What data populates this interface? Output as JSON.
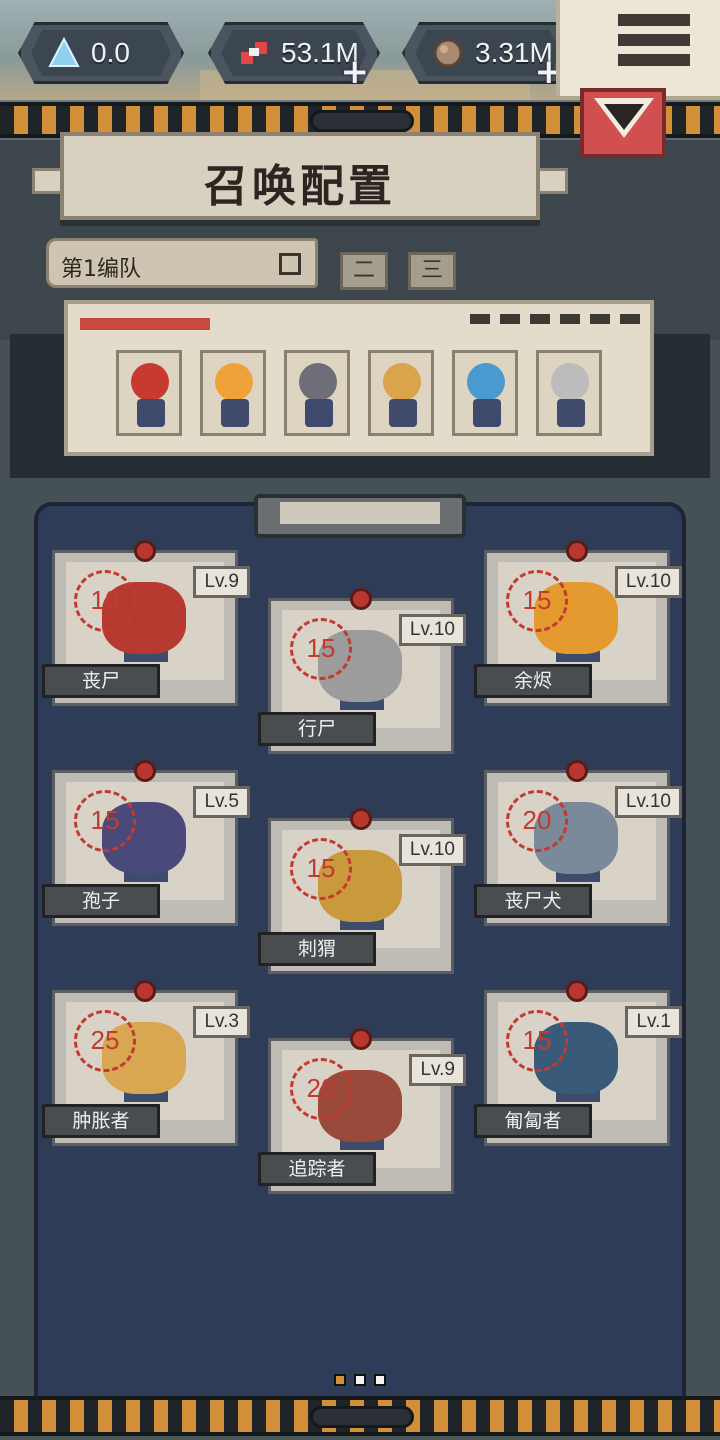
{
  "resources": [
    {
      "icon": "crystal-icon",
      "value": "0.0",
      "has_plus": false
    },
    {
      "icon": "gene-icon",
      "value": "53.1M",
      "has_plus": true
    },
    {
      "icon": "ore-icon",
      "value": "3.31M",
      "has_plus": true
    }
  ],
  "header": {
    "title": "召唤配置",
    "team_label": "第1编队",
    "team_tabs": [
      "二",
      "三"
    ]
  },
  "formation": {
    "slots": [
      "apple",
      "ember",
      "walker",
      "hedgehog",
      "spore-blue",
      "ghost"
    ]
  },
  "cards": [
    {
      "name": "丧尸",
      "level": "Lv.9",
      "cost": "10",
      "color": "#b63a30"
    },
    {
      "name": "行尸",
      "level": "Lv.10",
      "cost": "15",
      "color": "#9c9c9c"
    },
    {
      "name": "余烬",
      "level": "Lv.10",
      "cost": "15",
      "color": "#e59a2f"
    },
    {
      "name": "孢子",
      "level": "Lv.5",
      "cost": "15",
      "color": "#4a4a7a"
    },
    {
      "name": "刺猬",
      "level": "Lv.10",
      "cost": "15",
      "color": "#c99a3c"
    },
    {
      "name": "丧尸犬",
      "level": "Lv.10",
      "cost": "20",
      "color": "#7a8a9a"
    },
    {
      "name": "肿胀者",
      "level": "Lv.3",
      "cost": "25",
      "color": "#d9a652"
    },
    {
      "name": "追踪者",
      "level": "Lv.9",
      "cost": "20",
      "color": "#9a4a3a"
    },
    {
      "name": "匍匐者",
      "level": "Lv.1",
      "cost": "15",
      "color": "#3a5a7a"
    }
  ],
  "pager": {
    "pages": 3,
    "active": 1
  },
  "colors": {
    "accent": "#d28f3a",
    "close": "#d04f4f",
    "board": "#2f3c57",
    "cost": "#c23a30"
  }
}
